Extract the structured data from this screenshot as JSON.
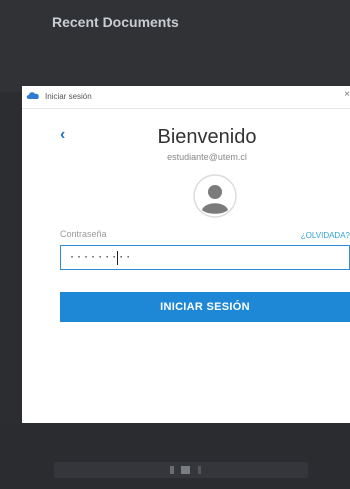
{
  "app": {
    "title": "Recent Documents"
  },
  "dialog": {
    "title": "Iniciar sesión",
    "close_label": "×",
    "back_label": "‹",
    "heading": "Bienvenido",
    "email": "estudiante@utem.cl",
    "password_label": "Contraseña",
    "forgot_label": "¿OLVIDADA?",
    "password_value": "·········",
    "submit_label": "INICIAR SESIÓN"
  },
  "colors": {
    "accent": "#1e88d6",
    "link": "#2fa3d4",
    "input_border": "#2f8fdd",
    "background_dark": "#2b2d31"
  },
  "icons": {
    "titlebar": "cloud-icon",
    "avatar": "user-avatar-icon",
    "back": "chevron-left-icon",
    "close": "close-icon"
  }
}
